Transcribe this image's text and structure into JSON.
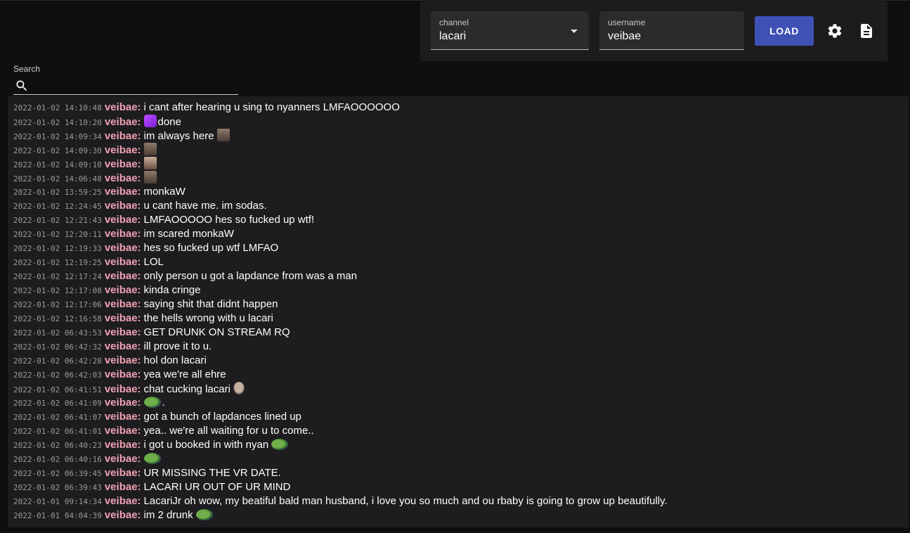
{
  "toolbar": {
    "channel_label": "channel",
    "channel_value": "lacari",
    "username_label": "username",
    "username_value": "veibae",
    "load_label": "LOAD",
    "settings_icon": "gear-icon",
    "document_icon": "document-icon",
    "accent": "#3f51b5"
  },
  "search": {
    "label": "Search",
    "value": "",
    "icon": "search-icon"
  },
  "username_color": "#f0a0b2",
  "messages": [
    {
      "ts": "2022-01-02 14:10:48",
      "user": "veibae:",
      "text": "i cant after hearing u sing to nyanners LMFAOOOOOO",
      "emote": ""
    },
    {
      "ts": "2022-01-02 14:10:20",
      "user": "veibae:",
      "text": "done",
      "emote": "purple"
    },
    {
      "ts": "2022-01-02 14:09:34",
      "user": "veibae:",
      "text": "im always here",
      "emote": "face-after"
    },
    {
      "ts": "2022-01-02 14:09:30",
      "user": "veibae:",
      "text": "",
      "emote": "face"
    },
    {
      "ts": "2022-01-02 14:09:10",
      "user": "veibae:",
      "text": "",
      "emote": "face2"
    },
    {
      "ts": "2022-01-02 14:06:48",
      "user": "veibae:",
      "text": "",
      "emote": "face"
    },
    {
      "ts": "2022-01-02 13:59:25",
      "user": "veibae:",
      "text": "monkaW",
      "emote": ""
    },
    {
      "ts": "2022-01-02 12:24:45",
      "user": "veibae:",
      "text": "u cant have me. im sodas.",
      "emote": ""
    },
    {
      "ts": "2022-01-02 12:21:43",
      "user": "veibae:",
      "text": "LMFAOOOOO hes so fucked up wtf!",
      "emote": ""
    },
    {
      "ts": "2022-01-02 12:20:11",
      "user": "veibae:",
      "text": "im scared monkaW",
      "emote": ""
    },
    {
      "ts": "2022-01-02 12:19:33",
      "user": "veibae:",
      "text": "hes so fucked up wtf LMFAO",
      "emote": ""
    },
    {
      "ts": "2022-01-02 12:19:25",
      "user": "veibae:",
      "text": "LOL",
      "emote": ""
    },
    {
      "ts": "2022-01-02 12:17:24",
      "user": "veibae:",
      "text": "only person u got a lapdance from was a man",
      "emote": ""
    },
    {
      "ts": "2022-01-02 12:17:08",
      "user": "veibae:",
      "text": "kinda cringe",
      "emote": ""
    },
    {
      "ts": "2022-01-02 12:17:06",
      "user": "veibae:",
      "text": "saying shit that didnt happen",
      "emote": ""
    },
    {
      "ts": "2022-01-02 12:16:58",
      "user": "veibae:",
      "text": "the hells wrong with u lacari",
      "emote": ""
    },
    {
      "ts": "2022-01-02 06:43:53",
      "user": "veibae:",
      "text": "GET DRUNK ON STREAM RQ",
      "emote": ""
    },
    {
      "ts": "2022-01-02 06:42:32",
      "user": "veibae:",
      "text": "ill prove it to u.",
      "emote": ""
    },
    {
      "ts": "2022-01-02 06:42:28",
      "user": "veibae:",
      "text": "hol don lacari",
      "emote": ""
    },
    {
      "ts": "2022-01-02 06:42:03",
      "user": "veibae:",
      "text": "yea we're all ehre",
      "emote": ""
    },
    {
      "ts": "2022-01-02 06:41:51",
      "user": "veibae:",
      "text": "chat cucking lacari",
      "emote": "bald-after"
    },
    {
      "ts": "2022-01-02 06:41:09",
      "user": "veibae:",
      "text": ".",
      "emote": "frog"
    },
    {
      "ts": "2022-01-02 06:41:07",
      "user": "veibae:",
      "text": "got a bunch of lapdances lined up",
      "emote": ""
    },
    {
      "ts": "2022-01-02 06:41:01",
      "user": "veibae:",
      "text": "yea.. we're all waiting for u to come..",
      "emote": ""
    },
    {
      "ts": "2022-01-02 06:40:23",
      "user": "veibae:",
      "text": "i got u booked in with nyan",
      "emote": "frog-after"
    },
    {
      "ts": "2022-01-02 06:40:16",
      "user": "veibae:",
      "text": "",
      "emote": "frog"
    },
    {
      "ts": "2022-01-02 06:39:45",
      "user": "veibae:",
      "text": "UR MISSING THE VR DATE.",
      "emote": ""
    },
    {
      "ts": "2022-01-02 06:39:43",
      "user": "veibae:",
      "text": "LACARI UR OUT OF UR MIND",
      "emote": ""
    },
    {
      "ts": "2022-01-01 09:14:34",
      "user": "veibae:",
      "text": "LacariJr oh wow, my beatiful bald man husband, i love you so much and ou rbaby is going to grow up beautifully.",
      "emote": ""
    },
    {
      "ts": "2022-01-01 04:04:39",
      "user": "veibae:",
      "text": "im 2 drunk",
      "emote": "frog-after"
    }
  ]
}
